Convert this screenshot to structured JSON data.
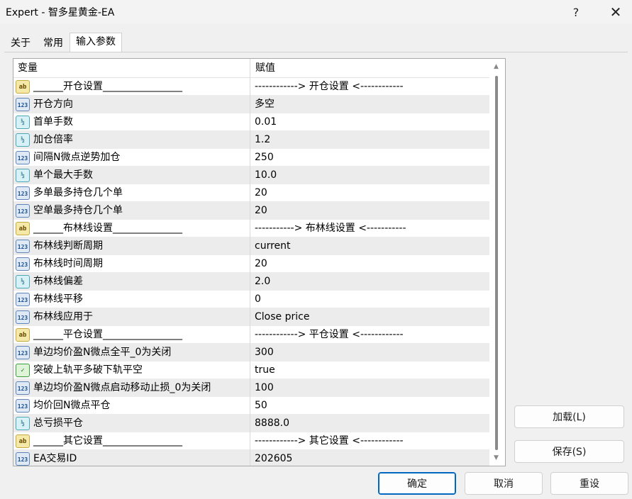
{
  "window": {
    "title": "Expert - 智多星黄金-EA",
    "help": "?",
    "close": "✕"
  },
  "tabs": [
    {
      "label": "关于"
    },
    {
      "label": "常用"
    },
    {
      "label": "输入参数"
    }
  ],
  "grid": {
    "col_variable": "变量",
    "col_value": "赋值",
    "rows": [
      {
        "icon": "ab",
        "name": "______开仓设置________________",
        "value": "------------> 开仓设置 <------------"
      },
      {
        "icon": "123",
        "name": "开仓方向",
        "value": "多空"
      },
      {
        "icon": "1/2",
        "name": "首单手数",
        "value": "0.01"
      },
      {
        "icon": "1/2",
        "name": "加仓倍率",
        "value": "1.2"
      },
      {
        "icon": "123",
        "name": "间隔N微点逆势加仓",
        "value": "250"
      },
      {
        "icon": "1/2",
        "name": "单个最大手数",
        "value": "10.0"
      },
      {
        "icon": "123",
        "name": "多单最多持仓几个单",
        "value": "20"
      },
      {
        "icon": "123",
        "name": "空单最多持仓几个单",
        "value": "20"
      },
      {
        "icon": "ab",
        "name": "______布林线设置______________",
        "value": "-----------> 布林线设置 <-----------"
      },
      {
        "icon": "123",
        "name": "布林线判断周期",
        "value": "current"
      },
      {
        "icon": "123",
        "name": "布林线时间周期",
        "value": "20"
      },
      {
        "icon": "1/2",
        "name": "布林线偏差",
        "value": "2.0"
      },
      {
        "icon": "123",
        "name": "布林线平移",
        "value": "0"
      },
      {
        "icon": "123",
        "name": "布林线应用于",
        "value": "Close price"
      },
      {
        "icon": "ab",
        "name": "______平仓设置________________",
        "value": "------------> 平仓设置 <------------"
      },
      {
        "icon": "123",
        "name": "单边均价盈N微点全平_0为关闭",
        "value": "300"
      },
      {
        "icon": "bool",
        "name": "突破上轨平多破下轨平空",
        "value": "true"
      },
      {
        "icon": "123",
        "name": "单边均价盈N微点启动移动止损_0为关闭",
        "value": "100"
      },
      {
        "icon": "123",
        "name": "均价回N微点平仓",
        "value": "50"
      },
      {
        "icon": "1/2",
        "name": "总亏损平仓",
        "value": "8888.0"
      },
      {
        "icon": "ab",
        "name": "______其它设置________________",
        "value": "------------> 其它设置 <------------"
      },
      {
        "icon": "123",
        "name": "EA交易ID",
        "value": "202605"
      }
    ]
  },
  "buttons": {
    "load": "加载(L)",
    "save": "保存(S)",
    "ok": "确定",
    "cancel": "取消",
    "reset": "重设"
  }
}
